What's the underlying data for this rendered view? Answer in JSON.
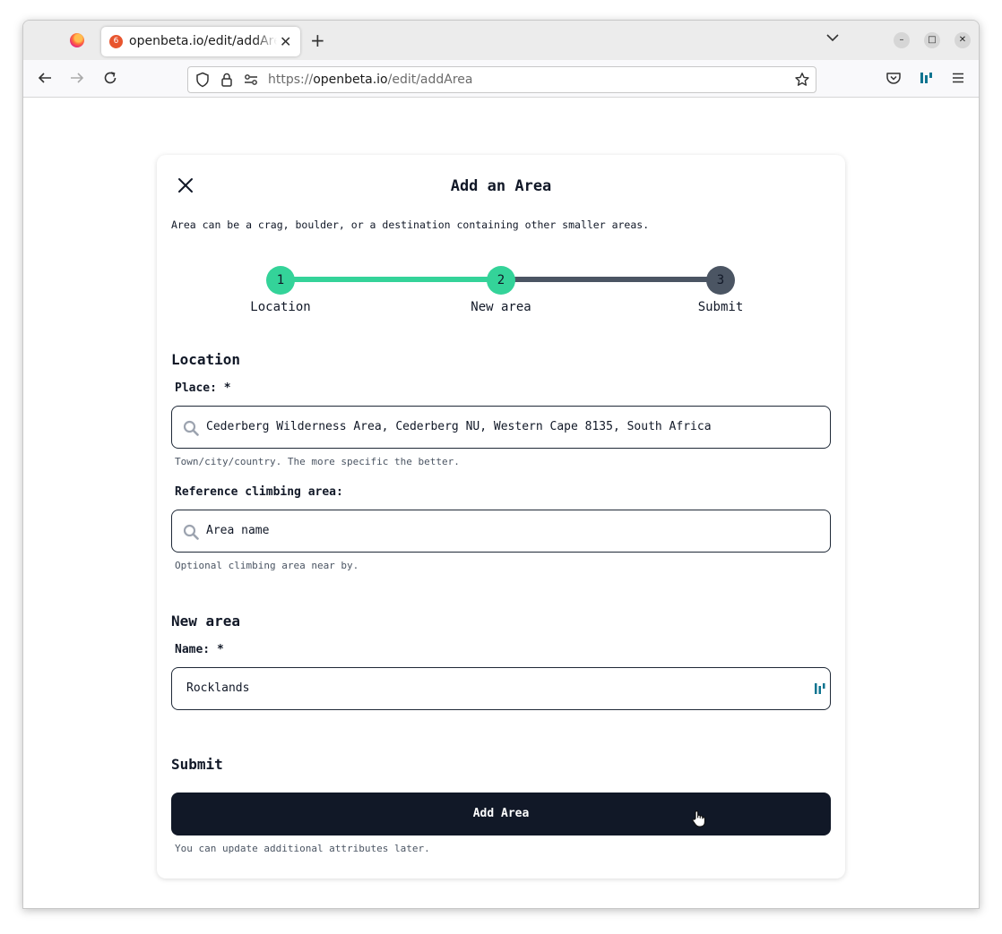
{
  "browser": {
    "tab_title": "openbeta.io/edit/addArea",
    "tab_favicon_glyph": "6",
    "url_scheme": "https://",
    "url_host": "openbeta.io",
    "url_path": "/edit/addArea",
    "icons": [
      "firefox-icon",
      "back-icon",
      "forward-icon",
      "reload-icon",
      "shield-icon",
      "lock-icon",
      "permissions-icon",
      "bookmark-star-icon",
      "pocket-icon",
      "extension-icon",
      "menu-icon"
    ]
  },
  "modal": {
    "title": "Add an Area",
    "description": "Area can be a crag, boulder, or a destination containing other smaller areas.",
    "steps": [
      {
        "number": "1",
        "label": "Location",
        "state": "complete"
      },
      {
        "number": "2",
        "label": "New area",
        "state": "current"
      },
      {
        "number": "3",
        "label": "Submit",
        "state": "pending"
      }
    ],
    "location": {
      "section_title": "Location",
      "place_label": "Place: *",
      "place_value": "Cederberg Wilderness Area, Cederberg NU, Western Cape 8135, South Africa",
      "place_hint": "Town/city/country. The more specific the better.",
      "reference_label": "Reference climbing area:",
      "reference_placeholder": "Area name",
      "reference_hint": "Optional climbing area near by."
    },
    "new_area": {
      "section_title": "New area",
      "name_label": "Name: *",
      "name_value": "Rocklands"
    },
    "submit": {
      "section_title": "Submit",
      "button_label": "Add Area",
      "hint": "You can update additional attributes later."
    }
  },
  "colors": {
    "accent_green": "#34d399",
    "pending_gray": "#4b5563",
    "button_dark": "#111827"
  }
}
